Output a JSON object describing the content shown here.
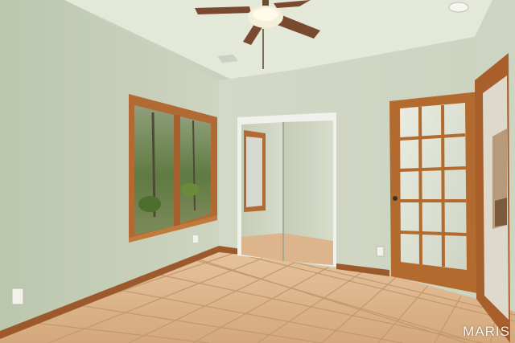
{
  "photo": {
    "subject": "room-interior",
    "colors": {
      "wall_left": "#c2ccb3",
      "wall_back": "#d2d9c6",
      "ceiling": "#e6eadc",
      "floor_tile": "#dcb58c",
      "grout": "#c59a70",
      "wood_trim": "#b0652d",
      "baseboard": "#9c5a2c"
    }
  },
  "watermark": {
    "text": "MARIS"
  }
}
